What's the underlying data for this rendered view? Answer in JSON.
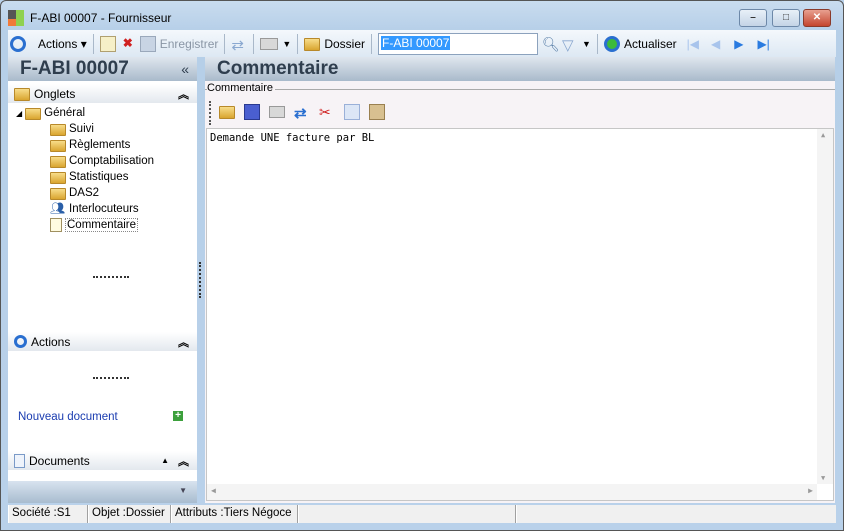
{
  "window": {
    "title": "F-ABI 00007 -  Fournisseur"
  },
  "toolbar": {
    "actions": "Actions",
    "save": "Enregistrer",
    "dossier": "Dossier",
    "search_value": "F-ABI 00007",
    "refresh": "Actualiser"
  },
  "left": {
    "title": "F-ABI 00007",
    "collapse": "«",
    "onglets": "Onglets",
    "tree": [
      "Général",
      "Suivi",
      "Règlements",
      "Comptabilisation",
      "Statistiques",
      "DAS2",
      "Interlocuteurs",
      "Commentaire"
    ],
    "actions": "Actions",
    "documents": "Documents",
    "new_document": "Nouveau document"
  },
  "right": {
    "title": "Commentaire",
    "group_label": "Commentaire",
    "text": "Demande UNE facture par BL"
  },
  "status": {
    "societe": "Société :S1",
    "objet": "Objet :Dossier",
    "attributs": "Attributs :Tiers Négoce"
  }
}
